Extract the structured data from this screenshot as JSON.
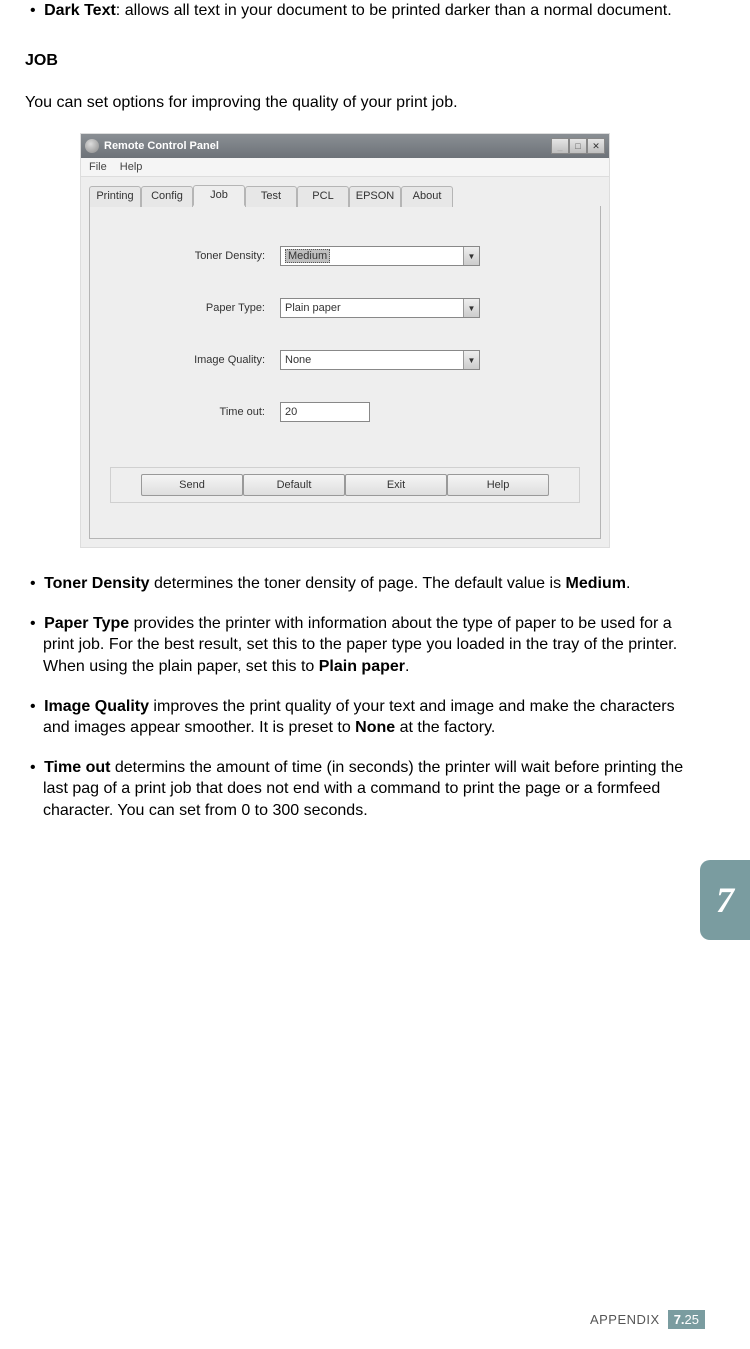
{
  "text": {
    "dark_text_bold": "Dark Text",
    "dark_text_body": ": allows all text in your document to be printed darker than a normal document.",
    "job_heading": "JOB",
    "job_intro": "You can set options for improving the quality of your print job.",
    "toner_bold": "Toner Density",
    "toner_body": " determines the toner density of page. The default value is ",
    "toner_bold2": "Medium",
    "toner_body2": ".",
    "paper_bold": "Paper Type",
    "paper_body": " provides the printer with information about the type of paper to be used for a print job. For the best result, set this to the paper type you loaded in the tray of the printer. When using the plain paper, set this to ",
    "paper_bold2": "Plain paper",
    "paper_body2": ".",
    "image_bold": "Image Quality",
    "image_body": " improves the print quality of your text and image and make the characters and images appear smoother. It is preset to ",
    "image_bold2": "None",
    "image_body2": " at the factory.",
    "timeout_bold": "Time out",
    "timeout_body": " determins the amount of time (in seconds) the printer will wait before printing the last pag of a print job that does not end with a command to print the page or a formfeed character. You can set from 0 to 300 seconds."
  },
  "window": {
    "title": "Remote Control Panel",
    "menu": {
      "file": "File",
      "help": "Help"
    },
    "tabs": {
      "printing": "Printing",
      "config": "Config",
      "job": "Job",
      "test": "Test",
      "pcl": "PCL",
      "epson": "EPSON",
      "about": "About"
    },
    "fields": {
      "toner_label": "Toner Density:",
      "toner_value": "Medium",
      "paper_label": "Paper Type:",
      "paper_value": "Plain paper",
      "image_label": "Image Quality:",
      "image_value": "None",
      "timeout_label": "Time out:",
      "timeout_value": "20"
    },
    "buttons": {
      "send": "Send",
      "default": "Default",
      "exit": "Exit",
      "help": "Help"
    }
  },
  "chapter_tab": "7",
  "footer": {
    "appendix": "APPENDIX",
    "chapter": "7.",
    "page": "25"
  }
}
